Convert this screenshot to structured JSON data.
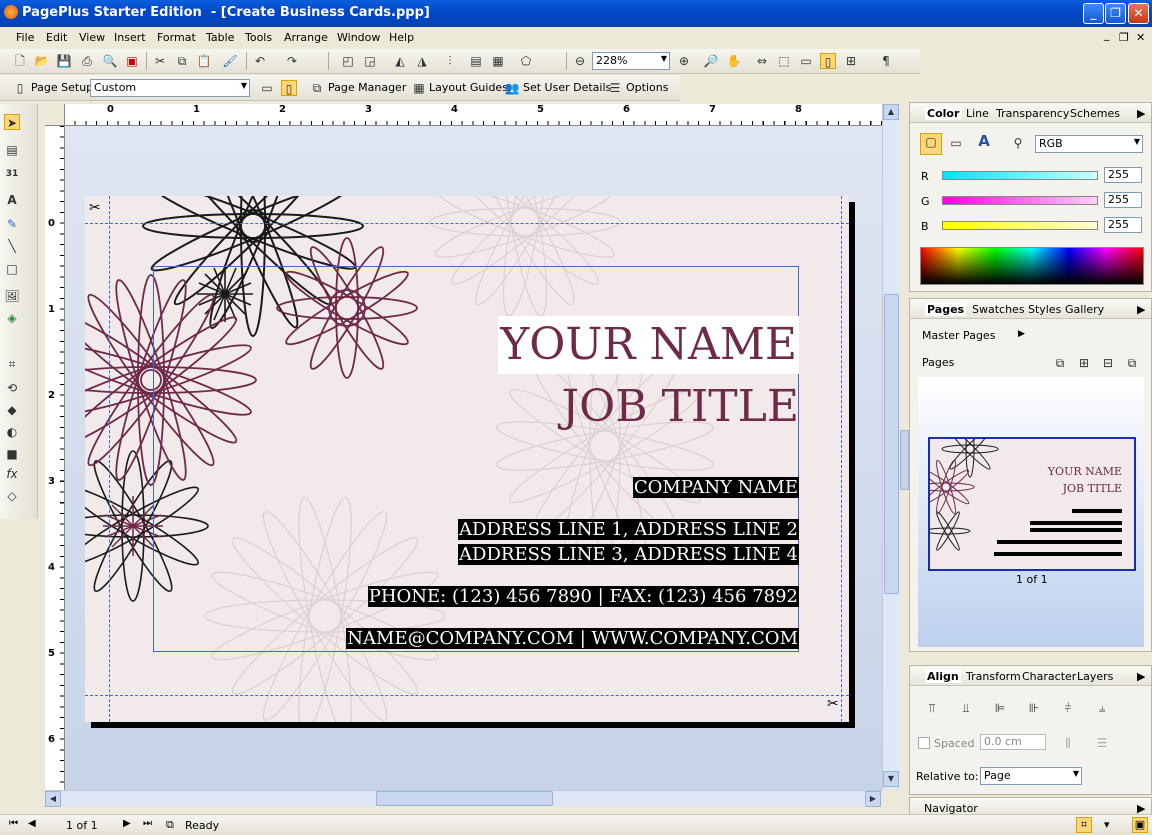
{
  "app": {
    "title": "PagePlus Starter Edition  - [Create Business Cards.ppp]"
  },
  "window_controls": {
    "minimize": "_",
    "restore": "❐",
    "close": "✕"
  },
  "menu": [
    "File",
    "Edit",
    "View",
    "Insert",
    "Format",
    "Table",
    "Tools",
    "Arrange",
    "Window",
    "Help"
  ],
  "mdi_controls": {
    "minimize": "_",
    "restore": "❐",
    "close": "✕"
  },
  "toolbar": {
    "zoom_value": "228%",
    "paragraph_mark": "¶"
  },
  "context_toolbar": {
    "page_setup_label": "Page Setup",
    "page_size": "Custom",
    "page_manager_label": "Page Manager",
    "layout_guides_label": "Layout Guides",
    "set_user_details_label": "Set User Details",
    "options_label": "Options"
  },
  "ruler": {
    "top_numbers": [
      "0",
      "1",
      "2",
      "3",
      "4",
      "5",
      "6",
      "7",
      "8"
    ],
    "left_numbers": [
      "0",
      "1",
      "2",
      "3",
      "4",
      "5",
      "6"
    ]
  },
  "card": {
    "name": "YOUR NAME",
    "job_title": "JOB TITLE",
    "company": "COMPANY NAME",
    "address1": "ADDRESS LINE 1, ADDRESS LINE 2",
    "address2": "ADDRESS LINE 3, ADDRESS LINE 4",
    "phone_fax": "PHONE: (123) 456 7890  |  FAX: (123) 456 7892",
    "email_web": "NAME@COMPANY.COM  |  WWW.COMPANY.COM"
  },
  "color_panel": {
    "tabs": [
      "Color",
      "Line",
      "Transparency",
      "Schemes"
    ],
    "model": "RGB",
    "channels": [
      {
        "label": "R",
        "value": "255",
        "color": "#00e5ff"
      },
      {
        "label": "G",
        "value": "255",
        "color": "#ff00e0"
      },
      {
        "label": "B",
        "value": "255",
        "color": "#ffff00"
      }
    ]
  },
  "pages_panel": {
    "tabs": [
      "Pages",
      "Swatches",
      "Styles",
      "Gallery"
    ],
    "master_pages_label": "Master Pages",
    "pages_label": "Pages",
    "page_count": "1 of 1",
    "thumb_name": "YOUR NAME",
    "thumb_job": "JOB TITLE"
  },
  "align_panel": {
    "tabs": [
      "Align",
      "Transform",
      "Character",
      "Layers"
    ],
    "spaced_label": "Spaced",
    "spaced_value": "0.0 cm",
    "relative_to_label": "Relative to:",
    "relative_to_value": "Page"
  },
  "navigator_panel": {
    "title": "Navigator"
  },
  "status": {
    "page_of": "1 of 1",
    "ready": "Ready"
  }
}
